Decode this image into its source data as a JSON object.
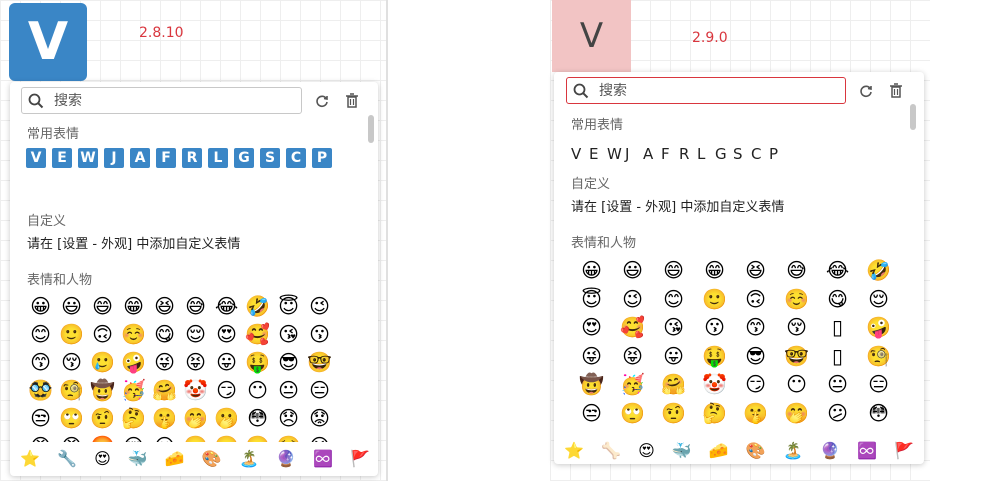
{
  "left": {
    "logo_letter": "V",
    "version": "2.8.10",
    "search": {
      "placeholder": "搜索",
      "value": ""
    },
    "sections": {
      "recent": "常用表情",
      "custom": "自定义",
      "people": "表情和人物"
    },
    "custom_hint": "请在 [设置 - 外观] 中添加自定义表情",
    "recent_items": [
      "V",
      "E",
      "W",
      "J",
      "A",
      "F",
      "R",
      "L",
      "G",
      "S",
      "C",
      "P"
    ],
    "emojis": [
      "😀",
      "😃",
      "😄",
      "😁",
      "😆",
      "😅",
      "😂",
      "🤣",
      "😇",
      "😉",
      "😊",
      "🙂",
      "🙃",
      "☺️",
      "😋",
      "😌",
      "😍",
      "🥰",
      "😘",
      "😗",
      "😙",
      "😚",
      "🥲",
      "🤪",
      "😜",
      "😝",
      "😛",
      "🤑",
      "😎",
      "🤓",
      "🥸",
      "🧐",
      "🤠",
      "🥳",
      "🤗",
      "🤡",
      "😏",
      "😶",
      "😐",
      "😑",
      "😒",
      "🙄",
      "🤨",
      "🤔",
      "🤫",
      "🤭",
      "🫢",
      "😳",
      "😞",
      "😟",
      "😠",
      "😡",
      "🤬",
      "😔",
      "😕",
      "🙁",
      "☹️",
      "😬",
      "🥺",
      "😣"
    ],
    "footer": [
      "⭐",
      "🔧",
      "😍",
      "🐳",
      "🧀",
      "🎨",
      "🏝️",
      "🔮",
      "♾️",
      "🚩"
    ]
  },
  "right": {
    "logo_letter": "V",
    "version": "2.9.0",
    "search": {
      "placeholder": "搜索",
      "value": ""
    },
    "sections": {
      "recent": "常用表情",
      "custom": "自定义",
      "people": "表情和人物"
    },
    "custom_hint": "请在 [设置 - 外观] 中添加自定义表情",
    "recent_items": [
      "V",
      "E",
      "W",
      "J",
      "A",
      "F",
      "R",
      "L",
      "G",
      "S",
      "C",
      "P"
    ],
    "emojis": [
      "😀",
      "😃",
      "😄",
      "😁",
      "😆",
      "😅",
      "😂",
      "🤣",
      "😇",
      "😉",
      "😊",
      "🙂",
      "🙃",
      "☺️",
      "😋",
      "😌",
      "😍",
      "🥰",
      "😘",
      "😗",
      "😙",
      "😚",
      "▯",
      "🤪",
      "😜",
      "😝",
      "😛",
      "🤑",
      "😎",
      "🤓",
      "▯",
      "🧐",
      "🤠",
      "🥳",
      "🤗",
      "🤡",
      "😏",
      "😶",
      "😐",
      "😑",
      "😒",
      "🙄",
      "🤨",
      "🤔",
      "🤫",
      "🤭",
      "😕",
      "😳"
    ],
    "footer": [
      "⭐",
      "🦴",
      "😍",
      "🐳",
      "🧀",
      "🎨",
      "🏝️",
      "🔮",
      "♾️",
      "🚩"
    ]
  },
  "colors": {
    "logo_blue": "#3a86c6",
    "logo_pink": "#f2c4c4",
    "version_red": "#d9363e",
    "search_focus": "#d9363e"
  }
}
